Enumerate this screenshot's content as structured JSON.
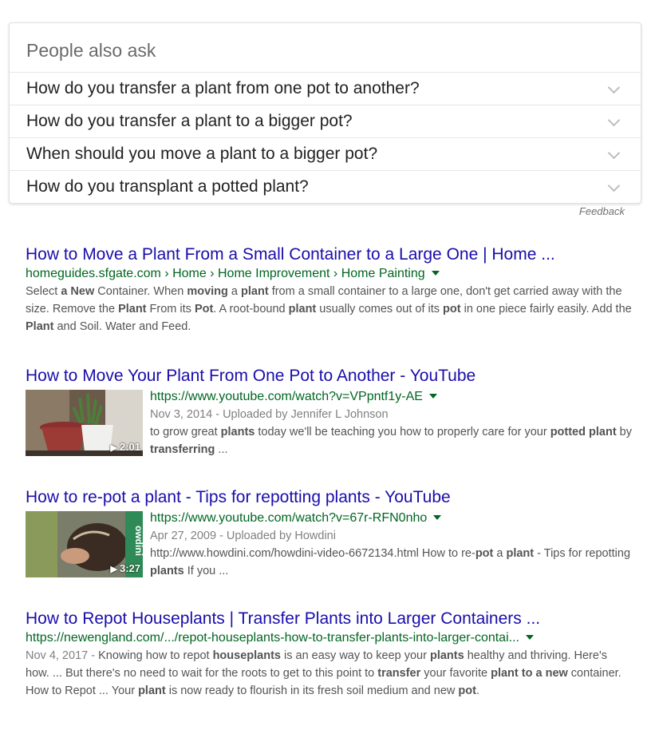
{
  "paa": {
    "title": "People also ask",
    "questions": [
      "How do you transfer a plant from one pot to another?",
      "How do you transfer a plant to a bigger pot?",
      "When should you move a plant to a bigger pot?",
      "How do you transplant a potted plant?"
    ],
    "feedback": "Feedback"
  },
  "results": [
    {
      "title": "How to Move a Plant From a Small Container to a Large One | Home ...",
      "url": "homeguides.sfgate.com › Home › Home Improvement › Home Painting",
      "snippet_html": "Select <b>a New</b> Container. When <b>moving</b> a <b>plant</b> from a small container to a large one, don't get carried away with the size. Remove the <b>Plant</b> From its <b>Pot</b>. A root-bound <b>plant</b> usually comes out of its <b>pot</b> in one piece fairly easily. Add the <b>Plant</b> and Soil. Water and Feed."
    },
    {
      "title": "How to Move Your Plant From One Pot to Another - YouTube",
      "url": "https://www.youtube.com/watch?v=VPpntf1y-AE",
      "date_line": "Nov 3, 2014 - Uploaded by Jennifer L Johnson",
      "snippet_html": "to grow great <b>plants</b> today we'll be teaching you how to properly care for your <b>potted plant</b> by <b>transferring</b> ...",
      "duration": "2:01"
    },
    {
      "title": "How to re-pot a plant - Tips for repotting plants - YouTube",
      "url": "https://www.youtube.com/watch?v=67r-RFN0nho",
      "date_line": "Apr 27, 2009 - Uploaded by Howdini",
      "snippet_html": "http://www.howdini.com/howdini-video-6672134.html How to re-<b>pot</b> a <b>plant</b> - Tips for repotting <b>plants</b> If you ...",
      "duration": "3:27",
      "thumb_text": "owdini"
    },
    {
      "title": "How to Repot Houseplants | Transfer Plants into Larger Containers ...",
      "url": "https://newengland.com/.../repot-houseplants-how-to-transfer-plants-into-larger-contai...",
      "date": "Nov 4, 2017",
      "snippet_html": "Knowing how to repot <b>houseplants</b> is an easy way to keep your <b>plants</b> healthy and thriving. Here's how. ... But there's no need to wait for the roots to get to this point to <b>transfer</b> your favorite <b>plant to a new</b> container. How to Repot ... Your <b>plant</b> is now ready to flourish in its fresh soil medium and new <b>pot</b>."
    }
  ],
  "colors": {
    "title": "#1a0dab",
    "url": "#006621",
    "snippet": "#545454"
  }
}
